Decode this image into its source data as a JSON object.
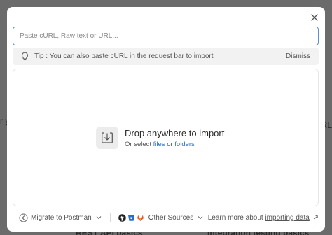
{
  "modal": {
    "input_placeholder": "Paste cURL, Raw text or URL...",
    "tip_text": "Tip : You can also paste cURL in the request bar to import",
    "dismiss_label": "Dismiss",
    "drop_title": "Drop anywhere to import",
    "drop_sub_prefix": "Or select",
    "files_link": "files",
    "drop_sub_middle": "or",
    "folders_link": "folders",
    "migrate_label": "Migrate to Postman",
    "other_sources_label": "Other Sources",
    "learn_prefix": "Learn more about",
    "learn_link": "importing data",
    "learn_suffix": "↗"
  },
  "background": {
    "bottom_left_text": "REST API basics",
    "bottom_right_text": "Integration testing basics",
    "right_text": "RL",
    "left_text": "r y"
  },
  "colors": {
    "accent": "#2a6fc9",
    "input_border": "#5c8fd6",
    "tip_bg": "#f2f2f2"
  }
}
